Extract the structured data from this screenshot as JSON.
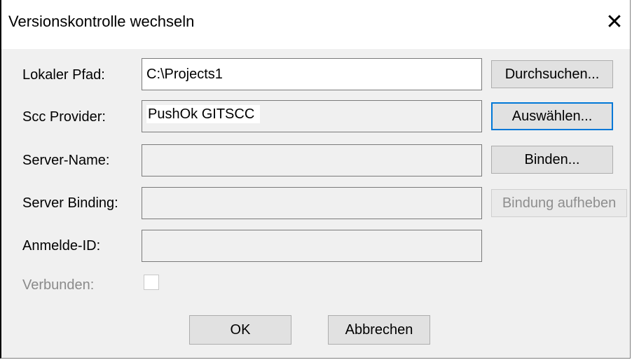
{
  "window": {
    "title": "Versionskontrolle wechseln",
    "close_icon": "close-icon"
  },
  "form": {
    "local_path_label": "Lokaler Pfad:",
    "local_path_value": "C:\\Projects1",
    "scc_provider_label": "Scc Provider:",
    "scc_provider_value": "PushOk GITSCC",
    "server_name_label": "Server-Name:",
    "server_name_value": "",
    "server_binding_label": "Server Binding:",
    "server_binding_value": "",
    "login_id_label": "Anmelde-ID:",
    "login_id_value": "",
    "connected_label": "Verbunden:"
  },
  "buttons": {
    "browse": "Durchsuchen...",
    "select": "Auswählen...",
    "bind": "Binden...",
    "unbind": "Bindung aufheben",
    "ok": "OK",
    "cancel": "Abbrechen"
  },
  "colors": {
    "focus": "#0078d7",
    "dialog_bg": "#f0f0f0"
  }
}
